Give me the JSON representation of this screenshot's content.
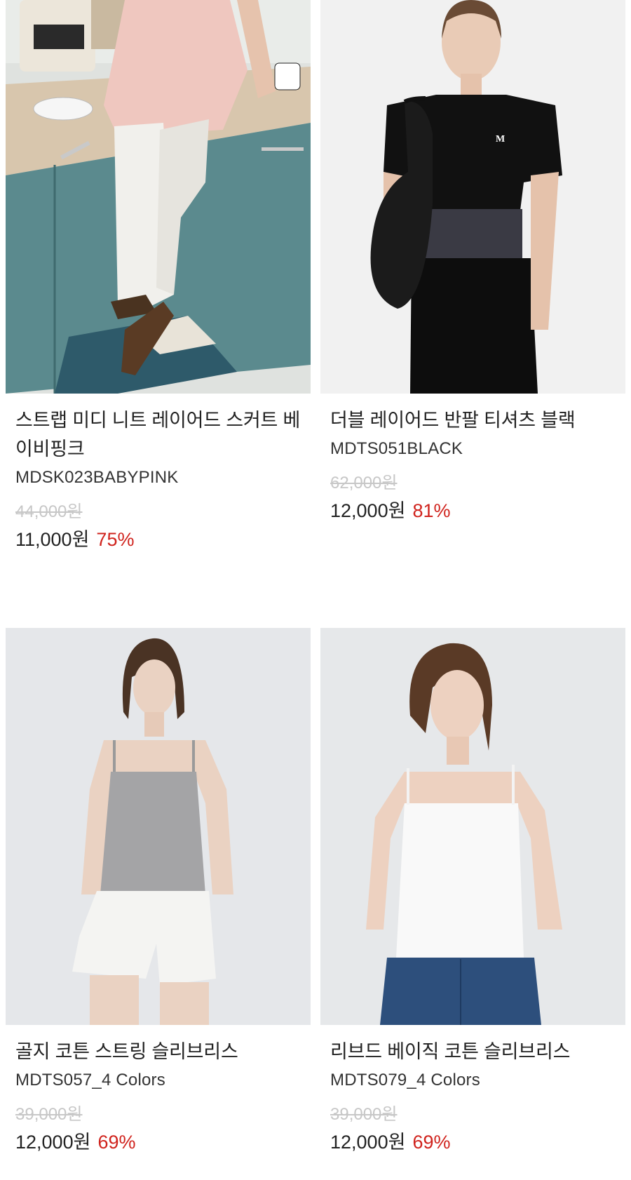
{
  "products": [
    {
      "title": "스트랩 미디 니트 레이어드 스커트 베이비핑크",
      "code": "MDSK023BABYPINK",
      "original_price": "44,000원",
      "price": "11,000원",
      "discount": "75%"
    },
    {
      "title": "더블 레이어드 반팔 티셔츠 블랙",
      "code": "MDTS051BLACK",
      "original_price": "62,000원",
      "price": "12,000원",
      "discount": "81%"
    },
    {
      "title": "골지 코튼 스트링 슬리브리스",
      "code": "MDTS057_4 Colors",
      "original_price": "39,000원",
      "price": "12,000원",
      "discount": "69%"
    },
    {
      "title": "리브드 베이직 코튼 슬리브리스",
      "code": "MDTS079_4 Colors",
      "original_price": "39,000원",
      "price": "12,000원",
      "discount": "69%"
    }
  ],
  "colors": {
    "discount": "#d0231d",
    "original_price": "#c7c7c7",
    "text": "#222222"
  }
}
